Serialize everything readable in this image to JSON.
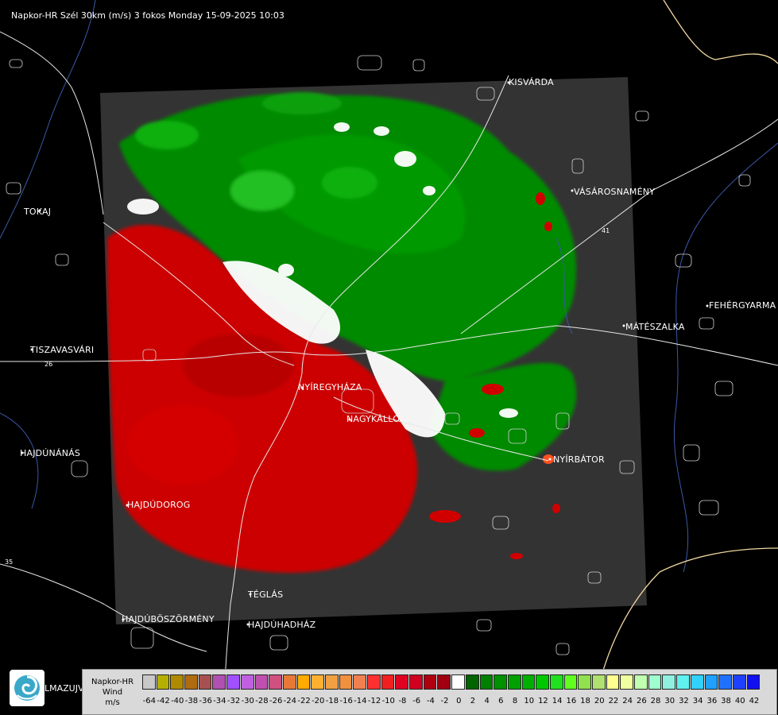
{
  "header": {
    "title": "Napkor-HR Szél 30km (m/s) 3 fokos Monday 15-09-2025 10:03"
  },
  "cities": [
    {
      "name": "KISVÁRDA"
    },
    {
      "name": "TOKAJ"
    },
    {
      "name": "VÁSÁROSNAMÉNY"
    },
    {
      "name": "FEHÉRGYARMA"
    },
    {
      "name": "MÁTÉSZALKA"
    },
    {
      "name": "TISZAVASVÁRI"
    },
    {
      "name": "NYÍREGYHÁZA"
    },
    {
      "name": "NAGYKÁLLÓ"
    },
    {
      "name": "NYÍRBÁTOR"
    },
    {
      "name": "HAJDÚNÁNÁS"
    },
    {
      "name": "HAJDÚDOROG"
    },
    {
      "name": "TÉGLÁS"
    },
    {
      "name": "HAJDÚBÖSZÖRMÉNY"
    },
    {
      "name": "HAJDÚHADHÁZ"
    }
  ],
  "roads": [
    "26",
    "35",
    "41"
  ],
  "legend": {
    "line1": "Napkor-HR",
    "line2": "Wind",
    "line3": "m/s",
    "ticks": [
      "-64",
      "-42",
      "-40",
      "-38",
      "-36",
      "-34",
      "-32",
      "-30",
      "-28",
      "-26",
      "-24",
      "-22",
      "-20",
      "-18",
      "-16",
      "-14",
      "-12",
      "-10",
      "-8",
      "-6",
      "-4",
      "-2",
      "0",
      "2",
      "4",
      "6",
      "8",
      "10",
      "12",
      "14",
      "16",
      "18",
      "20",
      "22",
      "24",
      "26",
      "28",
      "30",
      "32",
      "34",
      "36",
      "38",
      "40",
      "42"
    ],
    "colors": [
      "#c8c8c8",
      "#b5b000",
      "#b08a00",
      "#b06a10",
      "#a85050",
      "#b050b0",
      "#a050ff",
      "#c060e0",
      "#c050b0",
      "#d05080",
      "#e87838",
      "#ffaa00",
      "#ffb030",
      "#f0a040",
      "#f09040",
      "#f08050",
      "#ff3030",
      "#f02020",
      "#e00020",
      "#d00020",
      "#b00010",
      "#a00010",
      "#ffffff",
      "#006400",
      "#008000",
      "#009000",
      "#00a000",
      "#00b000",
      "#00c800",
      "#20e020",
      "#60ff20",
      "#90e050",
      "#b0e070",
      "#ffff90",
      "#f0ffa0",
      "#c0ffb0",
      "#a0ffd0",
      "#90f0e0",
      "#60f0f0",
      "#30d0ff",
      "#20a0ff",
      "#2070ff",
      "#2040ff",
      "#1010f0"
    ]
  },
  "logo": {
    "text": "LMAZUJVAR"
  }
}
